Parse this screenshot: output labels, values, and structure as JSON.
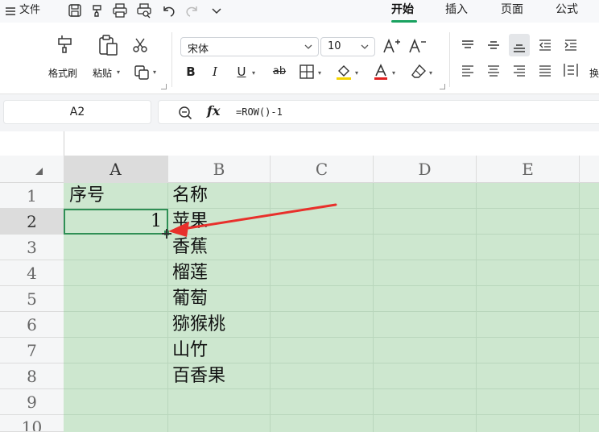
{
  "menubar": {
    "file_label": "文件",
    "tabs": [
      {
        "label": "开始",
        "active": true
      },
      {
        "label": "插入",
        "active": false
      },
      {
        "label": "页面",
        "active": false
      },
      {
        "label": "公式",
        "active": false
      }
    ],
    "quick_access_icons": [
      "save-icon",
      "format-painter-icon",
      "print-icon",
      "print-preview-icon",
      "undo-icon",
      "redo-icon",
      "chevron-down-icon"
    ]
  },
  "ribbon": {
    "format_painter_label": "格式刷",
    "paste_label": "粘贴",
    "font_name": "宋体",
    "font_size": "10",
    "partial_label": "换"
  },
  "formula_bar": {
    "cell_ref": "A2",
    "fx_label": "fx",
    "formula": "=ROW()-1"
  },
  "sheet": {
    "columns": [
      "A",
      "B",
      "C",
      "D",
      "E"
    ],
    "selected_column": "A",
    "rows": [
      "1",
      "2",
      "3",
      "4",
      "5",
      "6",
      "7",
      "8",
      "9",
      "10"
    ],
    "selected_row": "2",
    "cells": {
      "A1": "序号",
      "A2": "1",
      "B1": "名称",
      "B2": "苹果",
      "B3": "香蕉",
      "B4": "榴莲",
      "B5": "葡萄",
      "B6": "猕猴桃",
      "B7": "山竹",
      "B8": "百香果"
    }
  },
  "colors": {
    "accent_green": "#1aa260",
    "sheet_fill": "#cde7cf",
    "selection_border": "#2f8f55",
    "annotation_arrow": "#e8302b"
  }
}
